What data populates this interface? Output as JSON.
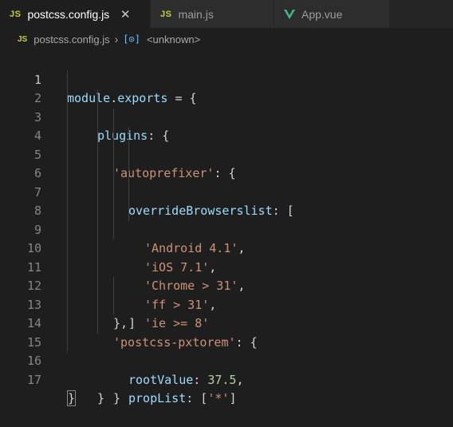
{
  "tabs": [
    {
      "icon": "JS",
      "label": "postcss.config.js",
      "active": true,
      "close": "✕"
    },
    {
      "icon": "JS",
      "label": "main.js",
      "active": false
    },
    {
      "icon": "vue-icon",
      "label": "App.vue",
      "active": false
    }
  ],
  "breadcrumb": {
    "file_icon": "JS",
    "file": "postcss.config.js",
    "separator": "›",
    "symbol_icon": "[⊙]",
    "symbol": "<unknown>"
  },
  "colors": {
    "editor_bg": "#1e1e1e",
    "tab_bar_bg": "#252526",
    "js_icon": "#cbcb41",
    "vue_icon": "#41b883",
    "string": "#ce9178",
    "property": "#9cdcfe",
    "number": "#b5cea8"
  },
  "editor": {
    "line_numbers": [
      "1",
      "2",
      "3",
      "4",
      "5",
      "6",
      "7",
      "8",
      "9",
      "10",
      "11",
      "12",
      "13",
      "14",
      "15",
      "16",
      "17"
    ],
    "code": {
      "l1_module": "module",
      "l1_dot": ".",
      "l1_exports": "exports",
      "l1_rest": " = {",
      "l2_prop": "plugins",
      "l2_rest": ": {",
      "l3_str": "'autoprefixer'",
      "l3_rest": ": {",
      "l4_prop": "overrideBrowserslist",
      "l4_rest": ": [",
      "l5_str": "'Android 4.1'",
      "l5_rest": ",",
      "l6_str": "'iOS 7.1'",
      "l6_rest": ",",
      "l7_str": "'Chrome > 31'",
      "l7_rest": ",",
      "l8_str": "'ff > 31'",
      "l8_rest": ",",
      "l9_str": "'ie >= 8'",
      "l10": "]",
      "l11": "},",
      "l12_str": "'postcss-pxtorem'",
      "l12_rest": ": {",
      "l13_prop": "rootValue",
      "l13_colon": ": ",
      "l13_num": "37.5",
      "l13_rest": ",",
      "l14_prop": "propList",
      "l14_colon": ": [",
      "l14_str": "'*'",
      "l14_rest": "]",
      "l15": "}",
      "l16": "}",
      "l17": "}"
    }
  }
}
